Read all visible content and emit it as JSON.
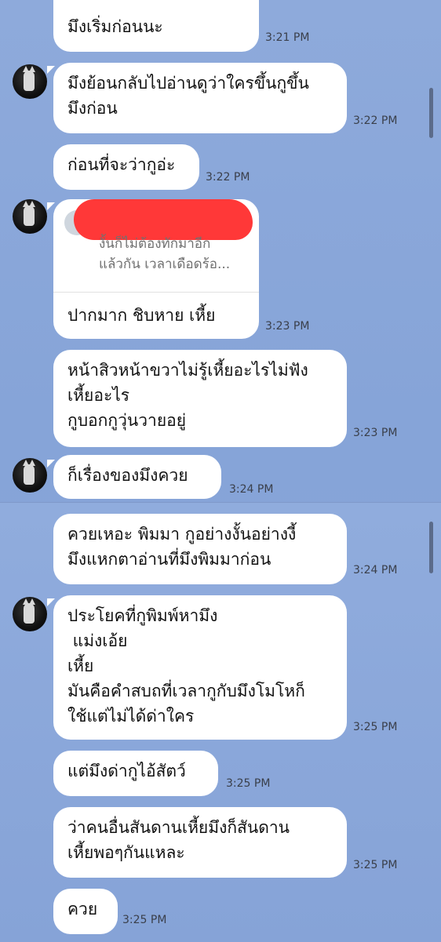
{
  "messages": [
    {
      "lines": [
        "มึงเริ่มก่อนนะ"
      ],
      "time": "3:21 PM"
    },
    {
      "lines": [
        "มึงย้อนกลับไปอ่านดูว่าใครขึ้นกูขึ้น",
        "มึงก่อน"
      ],
      "time": "3:22 PM"
    },
    {
      "lines": [
        "ก่อนที่จะว่ากูอ่ะ"
      ],
      "time": "3:22 PM"
    },
    {
      "quote": [
        "งั้นก็ไม่ต้องทักมาอีก",
        "แล้วกัน เวลาเดือดร้อ..."
      ],
      "lines": [
        "ปากมาก ชิบหาย เหี้ย"
      ],
      "time": "3:23 PM"
    },
    {
      "lines": [
        "หน้าสิวหน้าขวาไม่รู้เหี้ยอะไรไม่ฟัง",
        "เหี้ยอะไร",
        "กูบอกกูวุ่นวายอยู่"
      ],
      "time": "3:23 PM"
    },
    {
      "lines": [
        "ก็เรื่องของมึงควย"
      ],
      "time": "3:24 PM"
    },
    {
      "lines": [
        "ควยเหอะ พิมมา กูอย่างงั้นอย่างงี้",
        "มึงแหกตาอ่านที่มึงพิมมาก่อน"
      ],
      "time": "3:24 PM"
    },
    {
      "lines": [
        "ประโยคที่กูพิมพ์หามึง",
        " แม่งเอ้ย",
        "เหี้ย",
        "มันคือคำสบถที่เวลากูกับมึงโมโหก็",
        "ใช้แต่ไม่ได้ด่าใคร"
      ],
      "time": "3:25 PM"
    },
    {
      "lines": [
        "แต่มึงด่ากูไอ้สัตว์"
      ],
      "time": "3:25 PM"
    },
    {
      "lines": [
        "ว่าคนอื่นสันดานเหี้ยมึงก็สันดาน",
        "เหี้ยพอๆกันแหละ"
      ],
      "time": "3:25 PM"
    },
    {
      "lines": [
        "ควย"
      ],
      "time": "3:25 PM"
    }
  ]
}
